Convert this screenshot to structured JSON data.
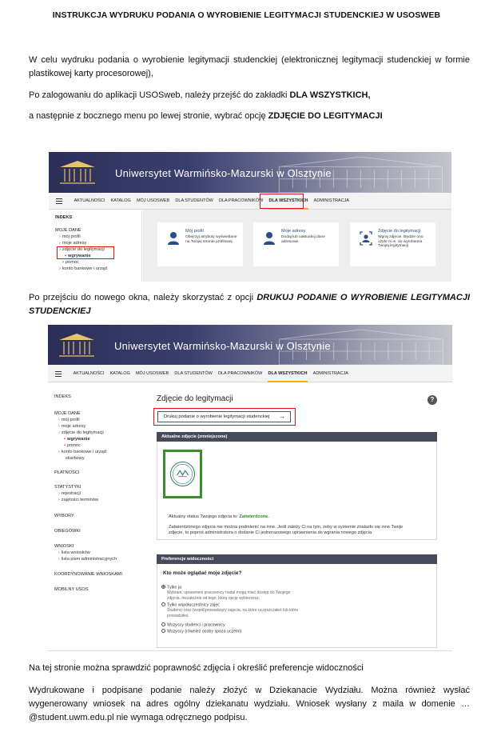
{
  "document": {
    "title": "INSTRUKCJA WYDRUKU PODANIA O WYROBIENIE LEGITYMACJI STUDENCKIEJ W USOSWEB",
    "p1": "W celu wydruku podania o wyrobienie legitymacji studenckiej (elektronicznej legitymacji studenckiej w formie plastikowej karty procesorowej),",
    "p2_pre": "Po zalogowaniu do aplikacji USOSweb, należy przejść do zakładki ",
    "p2_bold": "DLA WSZYSTKICH,",
    "p3_pre": "a następnie z bocznego menu po lewej stronie, wybrać opcję ",
    "p3_bold": "ZDJĘCIE DO LEGITYMACJI",
    "p4_pre": "Po przejściu do nowego okna, należy skorzystać z opcji ",
    "p4_bold": "DRUKUJ PODANIE O WYROBIENIE LEGITYMACJI STUDENCKIEJ",
    "p5": "Na tej stronie można sprawdzić poprawność zdjęcia i określić preferencje widoczności",
    "p6": "Wydrukowane i podpisane podanie należy złożyć w Dziekanacie Wydziału. Można również wysłać wygenerowany wniosek na adres ogólny dziekanatu wydziału. Wniosek wysłany z maila w domenie …@student.uwm.edu.pl nie wymaga odręcznego podpisu."
  },
  "usos": {
    "site_title": "Uniwersytet Warmińsko-Mazurski w Olsztynie",
    "nav": [
      "AKTUALNOŚCI",
      "KATALOG",
      "MÓJ USOSWEB",
      "DLA STUDENTÓW",
      "DLA PRACOWNIKÓW",
      "DLA WSZYSTKICH",
      "ADMINISTRACJA"
    ]
  },
  "shot1": {
    "sidebar": {
      "indeks": "INDEKS",
      "moje_dane": "MOJE DANE",
      "links": [
        "mój profil",
        "moje adresy",
        "zdjęcie do legitymacji"
      ],
      "sub": "wgrywanie",
      "links2": [
        "pomoc",
        "konto bankowe i urząd"
      ]
    },
    "cards": [
      {
        "title": "Mój profil",
        "desc": "Obejrzyj atrybuty wyświetlane na Twojej stronie profilowej."
      },
      {
        "title": "Moje adresy",
        "desc": "Dodaj lub uaktualnij dane adresowe."
      },
      {
        "title": "Zdjęcie do legitymacji",
        "desc": "Wgraj zdjęcie. Będzie ono użyte m.in. do wyrobienia Twojej legitymacji"
      }
    ]
  },
  "shot2": {
    "sidebar": {
      "indeks": "INDEKS",
      "moje_dane": "MOJE DANE",
      "md_links": [
        "mój profil",
        "moje adresy",
        "zdjęcie do legitymacji"
      ],
      "md_sub": "wgrywanie",
      "md_links2": [
        "pomoc",
        "konto bankowe i urząd"
      ],
      "md_cont": "skarbowy",
      "platnosci": "PŁATNOŚCI",
      "statystyki": "STATYSTYKI",
      "stat_links": [
        "rejestracji",
        "zajętości terminów"
      ],
      "wybory": "WYBORY",
      "obiegowki": "OBIEGÓWKI",
      "wnioski": "WNIOSKI",
      "wn_links": [
        "lista wniosków",
        "lista pism administracyjnych"
      ],
      "koord": "KOORDYNOWANIE WNIOSKAMI",
      "mobilny": "MOBILNY USOS"
    },
    "page_title": "Zdjęcie do legitymacji",
    "help": "?",
    "print_button": "Drukuj podanie o wyrobienie legitymacji studenckiej",
    "print_arrow": "→",
    "photo_panel_title": "Aktualne zdjęcie (zmniejszone)",
    "status_pre": "Aktualny status Twojego zdjęcia to: ",
    "status_value": "Zatwierdzone.",
    "approved_note_1": "Zatwierdzonego zdjęcia nie można podmienić na inne. Jeśli zależy Ci na tym, żeby w systemie znalazło się inne Twoje",
    "approved_note_2": "zdjęcie, to poproś administratora o dodanie Ci jednorazowego uprawnienia do wgrania nowego zdjęcia.",
    "pref_panel_title": "Preferencje widoczności",
    "pref_question": "Kto może oglądać moje zdjęcie?",
    "opt1": "Tylko ja",
    "opt1_desc_1": "Wybrani, uprawnieni pracownicy nadal mogą mieć dostęp do Twojego",
    "opt1_desc_2": "zdjęcia, niezależnie od tego, którą opcję wybierzesz.",
    "opt2": "Tylko współuczestnicy zajęć",
    "opt2_desc_1": "Studenci oraz (współ)prowadzący zajęcia, na które uczęszczałeś lub które",
    "opt2_desc_2": "prowadziłeś.",
    "opt3": "Wszyscy studenci i pracownicy",
    "opt4": "Wszyscy (również osoby spoza uczelni)"
  }
}
